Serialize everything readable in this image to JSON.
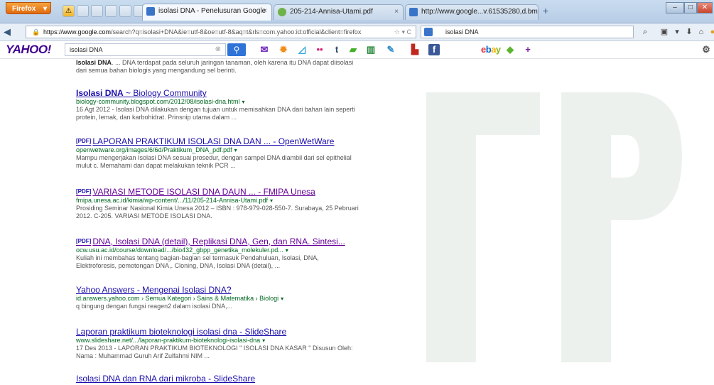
{
  "browser": {
    "menu_button": "Firefox",
    "tabs": [
      {
        "title": "isolasi DNA - Penelusuran Google",
        "active": true
      },
      {
        "title": "205-214-Annisa-Utami.pdf",
        "active": false
      },
      {
        "title": "http://www.google...v.61535280,d.bmk",
        "active": false
      }
    ],
    "url_host": "https://www.google.com",
    "url_path": "/search?q=isolasi+DNA&ie=utf-8&oe=utf-8&aq=t&rls=com.yahoo:id:official&client=firefox",
    "search_engine_text": "isolasi DNA"
  },
  "yahoo_toolbar": {
    "logo": "YAHOO!",
    "search_value": "isolasi DNA",
    "icons": [
      "mail-icon",
      "weather-icon",
      "finance-icon",
      "flickr-icon",
      "tumblr-icon",
      "news-icon",
      "sports-icon",
      "answers-icon",
      "bookmark-icon",
      "facebook-icon",
      "ebay-icon",
      "games-icon",
      "add-icon"
    ],
    "ebay": [
      "e",
      "b",
      "a",
      "y"
    ]
  },
  "results": [
    {
      "snippet_html_parts": [
        "Isolasi DNA",
        ". ... DNA terdapat pada seluruh jaringan tanaman, oleh karena itu DNA dapat diisolasi dari semua bahan biologis yang mengandung sel berinti."
      ]
    },
    {
      "title_a": "Isolasi DNA",
      "title_b": " ~ Biology Community",
      "url": "biology-community.blogspot.com/2012/08/isolasi-dna.html",
      "snippet": "16 Agt 2012 - Isolasi DNA dilakukan dengan tujuan untuk memisahkan DNA dari bahan lain seperti protein, lemak, dan karbohidrat. Prinsnip utama dalam ..."
    },
    {
      "tag": "[PDF]",
      "title": "LAPORAN PRAKTIKUM ISOLASI DNA DAN ... - OpenWetWare",
      "url": "openwetware.org/images/6/6d/Praktikum_DNA_pdf.pdf",
      "snippet": "Mampu mengerjakan Isolasi DNA sesuai prosedur, dengan sampel DNA diambil dari sel epithelial mulut c. Memahami dan dapat melakukan teknik PCR ..."
    },
    {
      "tag": "[PDF]",
      "title": "VARIASI METODE ISOLASI DNA DAUN ... - FMIPA Unesa",
      "url": "fmipa.unesa.ac.id/kimia/wp-content/.../11/205-214-Annisa-Utami.pdf",
      "snippet": "Prosiding Seminar Nasional Kimia Unesa 2012 – ISBN : 978-979-028-550-7. Surabaya, 25 Pebruari 2012. C-205. VARIASI METODE ISOLASI DNA."
    },
    {
      "tag": "[PDF]",
      "title": "DNA, Isolasi DNA (detail), Replikasi DNA, Gen, dan RNA. Sintesi...",
      "url": "ocw.usu.ac.id/course/download/.../bio432_gbpp_genetika_molekuler.pd...",
      "snippet": "Kuliah ini membahas tentang bagian-bagian sel termasuk Pendahuluan, Isolasi, DNA, Elektroforesis, pemotongan DNA,. Cloning, DNA, Isolasi DNA (detail), ..."
    },
    {
      "title": "Yahoo Answers - Mengenai Isolasi DNA?",
      "url": "id.answers.yahoo.com › Semua Kategori › Sains & Matematika › Biologi",
      "snippet": "q bingung dengan fungsi reagen2 dalam isolasi DNA,..."
    },
    {
      "title": "Laporan praktikum bioteknologi isolasi dna - SlideShare",
      "url": "www.slideshare.net/.../laporan-praktikum-bioteknologi-isolasi-dna",
      "snippet": "17 Des 2013 - LAPORAN PRAKTIKUM BIOTEKNOLOGI \" ISOLASI DNA KASAR \" Disusun Oleh: Nama : Muhammad Guruh Arif Zulfahmi NIM ..."
    },
    {
      "title": "Isolasi DNA dan RNA dari mikroba - SlideShare"
    }
  ]
}
